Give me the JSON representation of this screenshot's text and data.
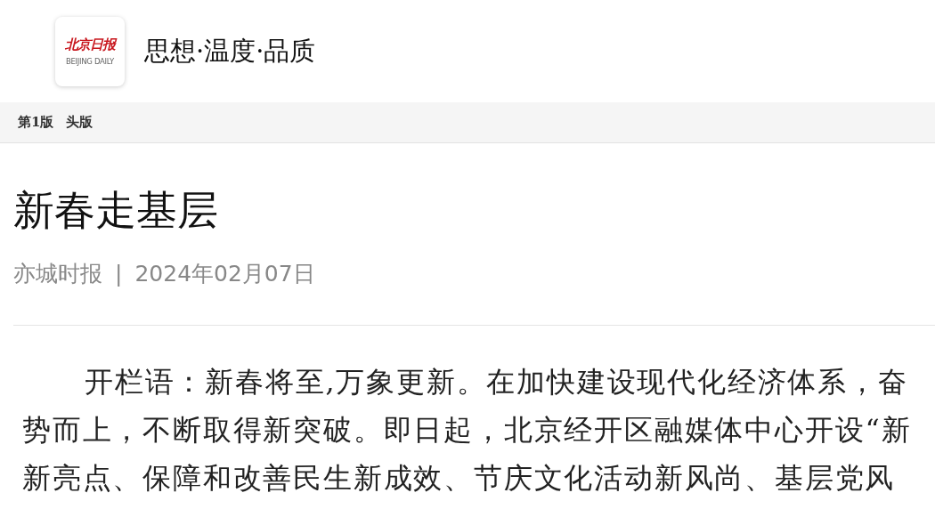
{
  "header": {
    "logo": {
      "name": "北京日报",
      "subtitle": "BEIJING DAILY"
    },
    "tagline": "思想·温度·品质"
  },
  "breadcrumb": [
    "第1版",
    "头版"
  ],
  "article": {
    "title": "新春走基层",
    "source": "亦城时报",
    "separator": "|",
    "date": "2024年02月07日",
    "lines": [
      "开栏语：新春将至,万象更新。在加快建设现代化经济体系，奋",
      "势而上，不断取得新突破。即日起，北京经开区融媒体中心开设“新",
      "新亮点、保障和改善民生新成效、节庆文化活动新风尚、基层党风"
    ]
  }
}
